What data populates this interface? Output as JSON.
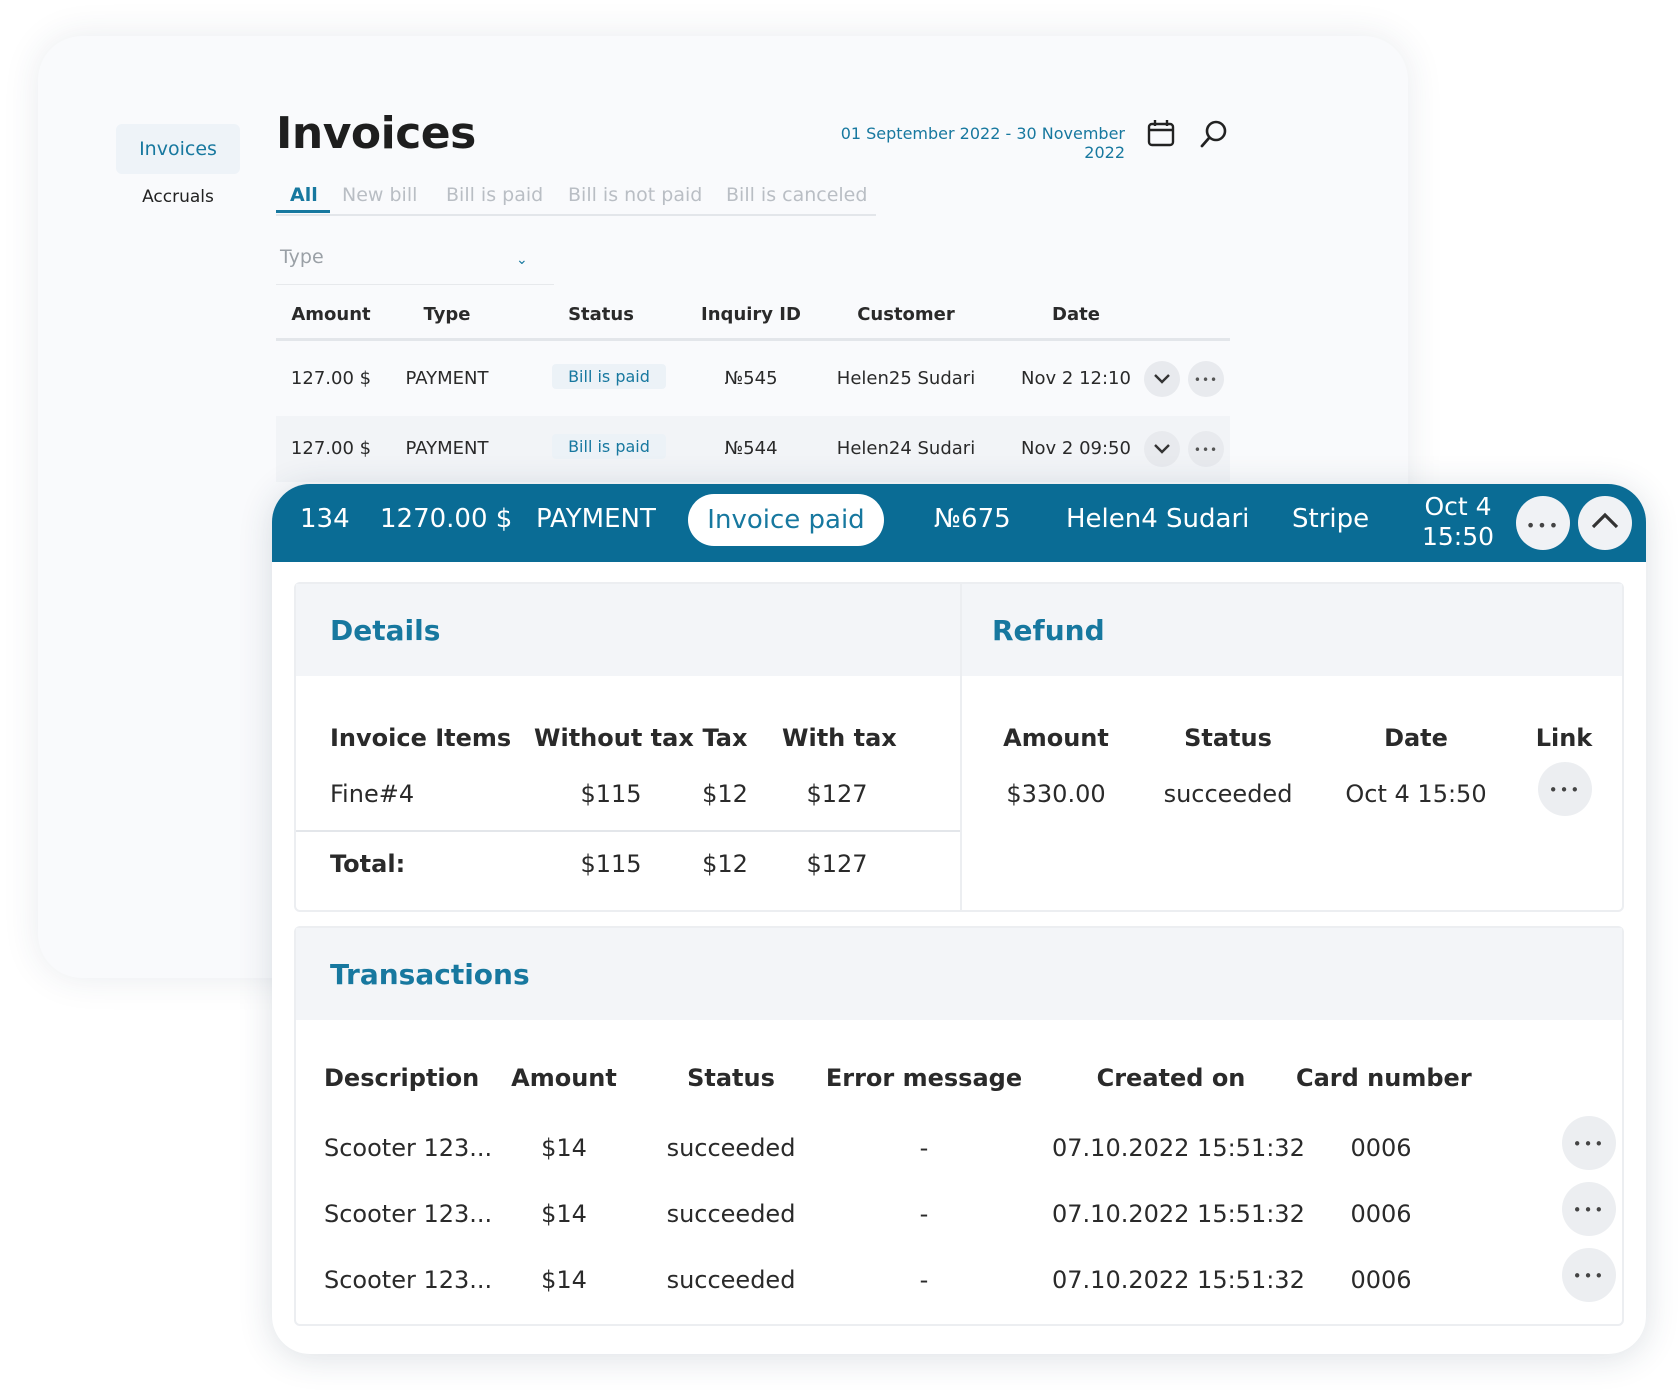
{
  "sidebar": {
    "items": [
      {
        "label": "Invoices"
      },
      {
        "label": "Accruals"
      }
    ]
  },
  "header": {
    "title": "Invoices",
    "date_range": "01 September 2022 - 30 November 2022",
    "icons": [
      "calendar-icon",
      "search-icon"
    ]
  },
  "tabs": [
    "All",
    "New bill",
    "Bill is paid",
    "Bill is not paid",
    "Bill is canceled"
  ],
  "type_select": {
    "label": "Type"
  },
  "table": {
    "headers": [
      "Amount",
      "Type",
      "Status",
      "Inquiry ID",
      "Customer",
      "Date"
    ],
    "rows": [
      {
        "amount": "127.00 $",
        "type": "PAYMENT",
        "status": "Bill is paid",
        "inquiry": "№545",
        "customer": "Helen25 Sudari",
        "date": "Nov 2 12:10"
      },
      {
        "amount": "127.00 $",
        "type": "PAYMENT",
        "status": "Bill is paid",
        "inquiry": "№544",
        "customer": "Helen24 Sudari",
        "date": "Nov 2 09:50"
      }
    ]
  },
  "expanded": {
    "id": "134",
    "amount": "1270.00 $",
    "type": "PAYMENT",
    "status": "Invoice paid",
    "inquiry": "№675",
    "customer": "Helen4 Sudari",
    "provider": "Stripe",
    "date_line1": "Oct 4",
    "date_line2": "15:50",
    "accent_color": "#0a6c95"
  },
  "details": {
    "title": "Details",
    "headers": [
      "Invoice Items",
      "Without tax",
      "Tax",
      "With tax"
    ],
    "item": {
      "name": "Fine#4",
      "without_tax": "$115",
      "tax": "$12",
      "with_tax": "$127"
    },
    "total": {
      "label": "Total:",
      "without_tax": "$115",
      "tax": "$12",
      "with_tax": "$127"
    }
  },
  "refund": {
    "title": "Refund",
    "headers": [
      "Amount",
      "Status",
      "Date",
      "Link"
    ],
    "row": {
      "amount": "$330.00",
      "status": "succeeded",
      "date": "Oct 4 15:50"
    }
  },
  "transactions": {
    "title": "Transactions",
    "headers": [
      "Description",
      "Amount",
      "Status",
      "Error message",
      "Created on",
      "Card number"
    ],
    "rows": [
      {
        "description": "Scooter 123...",
        "amount": "$14",
        "status": "succeeded",
        "error": "-",
        "created": "07.10.2022 15:51:32",
        "card": "0006"
      },
      {
        "description": "Scooter 123...",
        "amount": "$14",
        "status": "succeeded",
        "error": "-",
        "created": "07.10.2022 15:51:32",
        "card": "0006"
      },
      {
        "description": "Scooter 123...",
        "amount": "$14",
        "status": "succeeded",
        "error": "-",
        "created": "07.10.2022 15:51:32",
        "card": "0006"
      }
    ]
  },
  "glyphs": {
    "more": "•••",
    "chevron_down": "⌄"
  }
}
